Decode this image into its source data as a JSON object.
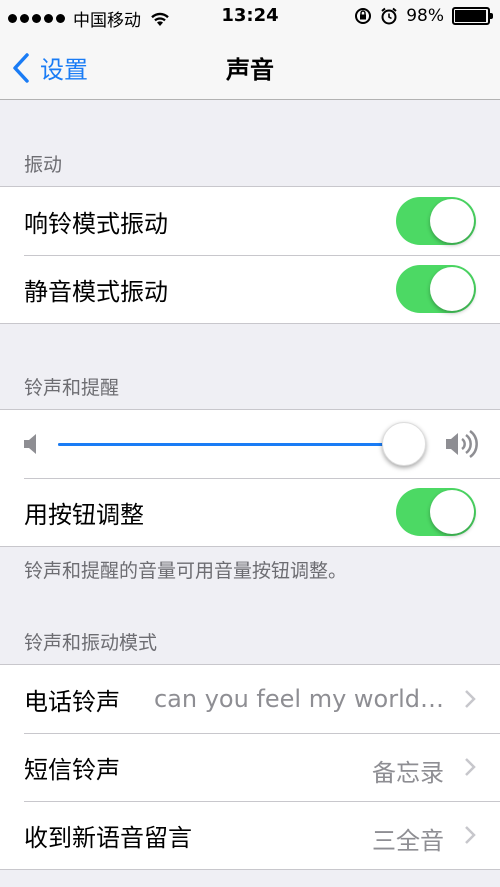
{
  "status_bar": {
    "carrier": "中国移动",
    "time": "13:24",
    "battery_text": "98%",
    "battery_level": 0.98
  },
  "nav": {
    "back_label": "设置",
    "title": "声音"
  },
  "sections": {
    "vibration_header": "振动",
    "ringer_alerts_header": "铃声和提醒",
    "sounds_patterns_header": "铃声和振动模式"
  },
  "vibration": {
    "ring_label": "响铃模式振动",
    "ring_on": true,
    "silent_label": "静音模式振动",
    "silent_on": true
  },
  "ringer": {
    "volume_level": 0.95,
    "change_with_buttons_label": "用按钮调整",
    "change_with_buttons_on": true,
    "footer_note": "铃声和提醒的音量可用音量按钮调整。"
  },
  "patterns": {
    "ringtone_label": "电话铃声",
    "ringtone_value": "can you feel my world…",
    "text_tone_label": "短信铃声",
    "text_tone_value": "备忘录",
    "voicemail_label": "收到新语音留言",
    "voicemail_value": "三全音"
  },
  "colors": {
    "accent": "#1a7cf5",
    "toggle_on": "#4cd964",
    "background": "#efeff4"
  },
  "icons": [
    "wifi-icon",
    "rotation-lock-icon",
    "alarm-icon",
    "battery-icon",
    "back-chevron-icon",
    "volume-low-icon",
    "volume-high-icon",
    "chevron-right-icon"
  ]
}
